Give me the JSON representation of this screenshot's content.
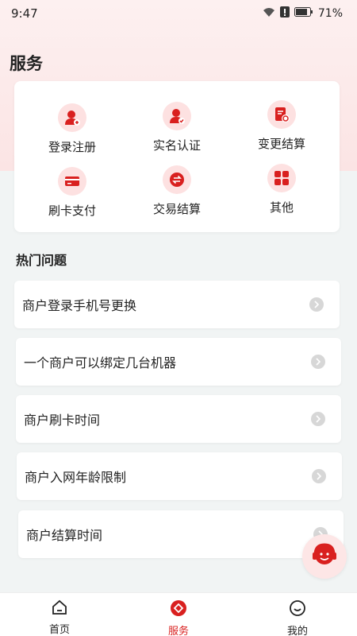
{
  "status_bar": {
    "time": "9:47",
    "battery": "71%"
  },
  "page": {
    "title": "服务"
  },
  "services": [
    {
      "label": "登录注册",
      "icon": "user-add-icon"
    },
    {
      "label": "实名认证",
      "icon": "user-verified-icon"
    },
    {
      "label": "变更结算",
      "icon": "document-refresh-icon"
    },
    {
      "label": "刷卡支付",
      "icon": "credit-card-icon"
    },
    {
      "label": "交易结算",
      "icon": "exchange-icon"
    },
    {
      "label": "其他",
      "icon": "grid-icon"
    }
  ],
  "hot": {
    "title": "热门问题",
    "items": [
      {
        "label": "商户登录手机号更换"
      },
      {
        "label": "一个商户可以绑定几台机器"
      },
      {
        "label": "商户刷卡时间"
      },
      {
        "label": "商户入网年龄限制"
      },
      {
        "label": "商户结算时间"
      }
    ]
  },
  "tabbar": {
    "items": [
      {
        "label": "首页",
        "icon": "home-icon",
        "active": false
      },
      {
        "label": "服务",
        "icon": "service-icon",
        "active": true
      },
      {
        "label": "我的",
        "icon": "profile-icon",
        "active": false
      }
    ]
  },
  "colors": {
    "accent": "#d9201f",
    "icon_bg": "#fde1e1"
  }
}
